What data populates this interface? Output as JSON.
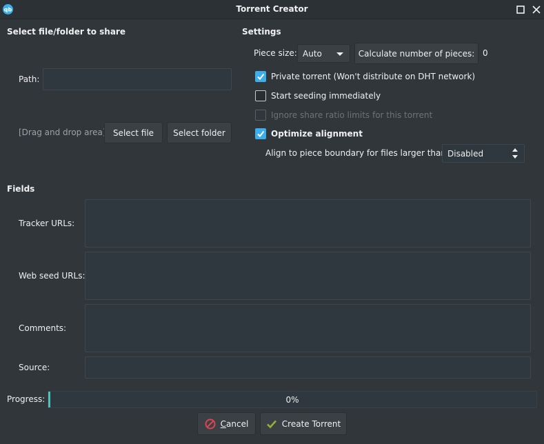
{
  "window": {
    "title": "Torrent Creator",
    "app_icon": "qbittorrent-icon",
    "controls": [
      "maximize-icon",
      "close-icon"
    ]
  },
  "share": {
    "section_title": "Select file/folder to share",
    "path_label": "Path:",
    "path_value": "",
    "drag_drop_label": "[Drag and drop area]",
    "select_file_label": "Select file",
    "select_folder_label": "Select folder"
  },
  "settings": {
    "section_title": "Settings",
    "piece_size_label": "Piece size:",
    "piece_size_value": "Auto",
    "calc_pieces_label": "Calculate number of pieces:",
    "pieces_count": "0",
    "private_torrent_label": "Private torrent (Won't distribute on DHT network)",
    "private_torrent_checked": true,
    "start_seeding_label": "Start seeding immediately",
    "start_seeding_checked": false,
    "ignore_ratio_label": "Ignore share ratio limits for this torrent",
    "ignore_ratio_checked": false,
    "ignore_ratio_enabled": false,
    "optimize_alignment_label": "Optimize alignment",
    "optimize_alignment_checked": true,
    "align_boundary_label": "Align to piece boundary for files larger than:",
    "align_boundary_value": "Disabled"
  },
  "fields": {
    "section_title": "Fields",
    "tracker_urls_label": "Tracker URLs:",
    "web_seed_urls_label": "Web seed URLs:",
    "comments_label": "Comments:",
    "source_label": "Source:"
  },
  "progress": {
    "label": "Progress:",
    "value": 0,
    "text": "0%"
  },
  "actions": {
    "cancel_label": "Cancel",
    "cancel_accel": "C",
    "cancel_rest": "ancel",
    "create_label": "Create Torrent"
  },
  "colors": {
    "accent": "#3daee9",
    "progress": "#4ec2b8",
    "background": "#31363b"
  }
}
